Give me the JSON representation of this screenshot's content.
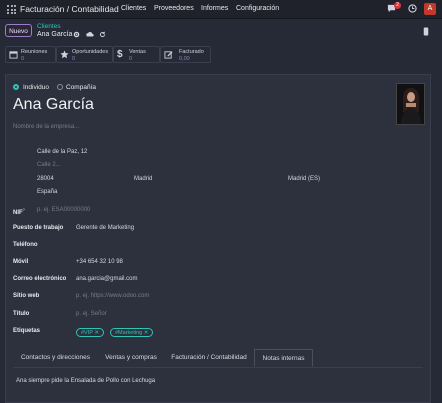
{
  "topbar": {
    "app_title": "Facturación / Contabilidad",
    "menu": [
      "Clientes",
      "Proveedores",
      "Informes",
      "Configuración"
    ],
    "chat_badge": "2",
    "user_initial": "A"
  },
  "control": {
    "new_label": "Nuevo",
    "breadcrumb_parent": "Clientes",
    "breadcrumb_current": "Ana García"
  },
  "smart_buttons": [
    {
      "label": "Reuniones",
      "value": "0",
      "icon": "calendar-icon"
    },
    {
      "label": "Oportunidades",
      "value": "0",
      "icon": "star-icon"
    },
    {
      "label": "Ventas",
      "value": "0",
      "icon": "dollar-icon"
    },
    {
      "label": "Facturado",
      "value": "0,00",
      "icon": "edit-icon"
    }
  ],
  "form": {
    "type_options": [
      "Individuo",
      "Compañía"
    ],
    "selected_type": "Individuo",
    "name": "Ana García",
    "company_placeholder": "Nombre de la empresa...",
    "address": {
      "street": "Calle de la Paz, 12",
      "street2_placeholder": "Calle 2...",
      "zip": "28004",
      "city": "Madrid",
      "state": "Madrid (ES)",
      "country": "España"
    },
    "nif_label": "NIF",
    "nif_sup": "?",
    "nif_placeholder": "p. ej. ESA00000000",
    "job_label": "Puesto de trabajo",
    "job_value": "Gerente de Marketing",
    "phone_label": "Teléfono",
    "mobile_label": "Móvil",
    "mobile_value": "+34 654 32 10 98",
    "email_label": "Correo electrónico",
    "email_value": "ana.garcia@gmail.com",
    "website_label": "Sitio web",
    "website_placeholder": "p. ej. https://www.odoo.com",
    "title_label": "Título",
    "title_placeholder": "p. ej. Señor",
    "tags_label": "Etiquetas",
    "tags": [
      "#VIP",
      "#Marketing"
    ]
  },
  "tabs": [
    "Contactos y direcciones",
    "Ventas y compras",
    "Facturación / Contabilidad",
    "Notas internas"
  ],
  "active_tab": "Notas internas",
  "internal_note": "Ana siempre pide la Ensalada de Pollo con Lechuga",
  "colors": {
    "accent": "#2ec4b6",
    "primary": "#9b7ec3",
    "background": "#262a36",
    "sheet": "#2d313e"
  }
}
